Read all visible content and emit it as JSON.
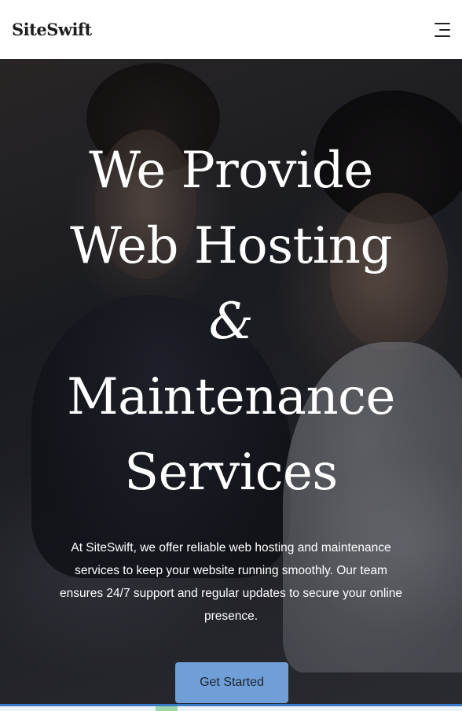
{
  "navbar": {
    "brand": "SiteSwift",
    "menu_icon": "hamburger-menu-icon"
  },
  "hero": {
    "title_lines": [
      "We Provide",
      "Web Hosting",
      "&",
      "Maintenance",
      "Services"
    ],
    "description": "At SiteSwift, we offer reliable web hosting and maintenance services to keep your website running smoothly. Our team ensures 24/7 support and regular updates to secure your online presence.",
    "cta_label": "Get Started",
    "background": "photo of two men looking at a laptop",
    "colors": {
      "cta_bg": "#6f9fd6",
      "title": "#ffffff",
      "accent_strip": "#3a7bc8"
    }
  }
}
